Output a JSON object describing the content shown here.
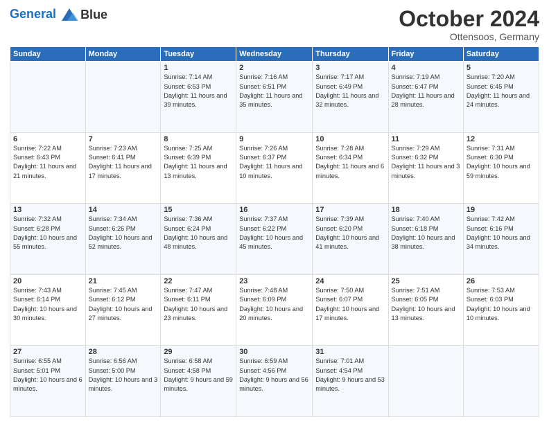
{
  "header": {
    "logo_line1": "General",
    "logo_line2": "Blue",
    "month": "October 2024",
    "location": "Ottensoos, Germany"
  },
  "weekdays": [
    "Sunday",
    "Monday",
    "Tuesday",
    "Wednesday",
    "Thursday",
    "Friday",
    "Saturday"
  ],
  "weeks": [
    [
      {
        "day": "",
        "info": ""
      },
      {
        "day": "",
        "info": ""
      },
      {
        "day": "1",
        "info": "Sunrise: 7:14 AM\nSunset: 6:53 PM\nDaylight: 11 hours and 39 minutes."
      },
      {
        "day": "2",
        "info": "Sunrise: 7:16 AM\nSunset: 6:51 PM\nDaylight: 11 hours and 35 minutes."
      },
      {
        "day": "3",
        "info": "Sunrise: 7:17 AM\nSunset: 6:49 PM\nDaylight: 11 hours and 32 minutes."
      },
      {
        "day": "4",
        "info": "Sunrise: 7:19 AM\nSunset: 6:47 PM\nDaylight: 11 hours and 28 minutes."
      },
      {
        "day": "5",
        "info": "Sunrise: 7:20 AM\nSunset: 6:45 PM\nDaylight: 11 hours and 24 minutes."
      }
    ],
    [
      {
        "day": "6",
        "info": "Sunrise: 7:22 AM\nSunset: 6:43 PM\nDaylight: 11 hours and 21 minutes."
      },
      {
        "day": "7",
        "info": "Sunrise: 7:23 AM\nSunset: 6:41 PM\nDaylight: 11 hours and 17 minutes."
      },
      {
        "day": "8",
        "info": "Sunrise: 7:25 AM\nSunset: 6:39 PM\nDaylight: 11 hours and 13 minutes."
      },
      {
        "day": "9",
        "info": "Sunrise: 7:26 AM\nSunset: 6:37 PM\nDaylight: 11 hours and 10 minutes."
      },
      {
        "day": "10",
        "info": "Sunrise: 7:28 AM\nSunset: 6:34 PM\nDaylight: 11 hours and 6 minutes."
      },
      {
        "day": "11",
        "info": "Sunrise: 7:29 AM\nSunset: 6:32 PM\nDaylight: 11 hours and 3 minutes."
      },
      {
        "day": "12",
        "info": "Sunrise: 7:31 AM\nSunset: 6:30 PM\nDaylight: 10 hours and 59 minutes."
      }
    ],
    [
      {
        "day": "13",
        "info": "Sunrise: 7:32 AM\nSunset: 6:28 PM\nDaylight: 10 hours and 55 minutes."
      },
      {
        "day": "14",
        "info": "Sunrise: 7:34 AM\nSunset: 6:26 PM\nDaylight: 10 hours and 52 minutes."
      },
      {
        "day": "15",
        "info": "Sunrise: 7:36 AM\nSunset: 6:24 PM\nDaylight: 10 hours and 48 minutes."
      },
      {
        "day": "16",
        "info": "Sunrise: 7:37 AM\nSunset: 6:22 PM\nDaylight: 10 hours and 45 minutes."
      },
      {
        "day": "17",
        "info": "Sunrise: 7:39 AM\nSunset: 6:20 PM\nDaylight: 10 hours and 41 minutes."
      },
      {
        "day": "18",
        "info": "Sunrise: 7:40 AM\nSunset: 6:18 PM\nDaylight: 10 hours and 38 minutes."
      },
      {
        "day": "19",
        "info": "Sunrise: 7:42 AM\nSunset: 6:16 PM\nDaylight: 10 hours and 34 minutes."
      }
    ],
    [
      {
        "day": "20",
        "info": "Sunrise: 7:43 AM\nSunset: 6:14 PM\nDaylight: 10 hours and 30 minutes."
      },
      {
        "day": "21",
        "info": "Sunrise: 7:45 AM\nSunset: 6:12 PM\nDaylight: 10 hours and 27 minutes."
      },
      {
        "day": "22",
        "info": "Sunrise: 7:47 AM\nSunset: 6:11 PM\nDaylight: 10 hours and 23 minutes."
      },
      {
        "day": "23",
        "info": "Sunrise: 7:48 AM\nSunset: 6:09 PM\nDaylight: 10 hours and 20 minutes."
      },
      {
        "day": "24",
        "info": "Sunrise: 7:50 AM\nSunset: 6:07 PM\nDaylight: 10 hours and 17 minutes."
      },
      {
        "day": "25",
        "info": "Sunrise: 7:51 AM\nSunset: 6:05 PM\nDaylight: 10 hours and 13 minutes."
      },
      {
        "day": "26",
        "info": "Sunrise: 7:53 AM\nSunset: 6:03 PM\nDaylight: 10 hours and 10 minutes."
      }
    ],
    [
      {
        "day": "27",
        "info": "Sunrise: 6:55 AM\nSunset: 5:01 PM\nDaylight: 10 hours and 6 minutes."
      },
      {
        "day": "28",
        "info": "Sunrise: 6:56 AM\nSunset: 5:00 PM\nDaylight: 10 hours and 3 minutes."
      },
      {
        "day": "29",
        "info": "Sunrise: 6:58 AM\nSunset: 4:58 PM\nDaylight: 9 hours and 59 minutes."
      },
      {
        "day": "30",
        "info": "Sunrise: 6:59 AM\nSunset: 4:56 PM\nDaylight: 9 hours and 56 minutes."
      },
      {
        "day": "31",
        "info": "Sunrise: 7:01 AM\nSunset: 4:54 PM\nDaylight: 9 hours and 53 minutes."
      },
      {
        "day": "",
        "info": ""
      },
      {
        "day": "",
        "info": ""
      }
    ]
  ]
}
